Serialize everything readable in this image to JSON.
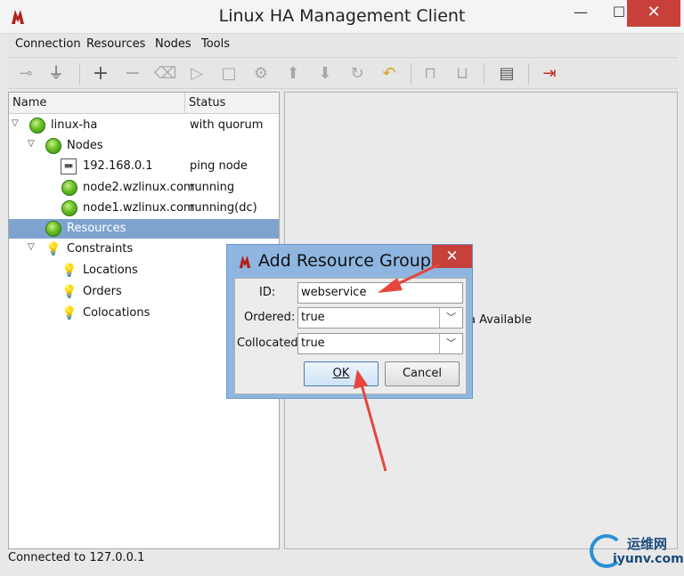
{
  "window": {
    "title": "Linux HA Management Client",
    "minimize": "—",
    "maximize": "☐",
    "close": "✕"
  },
  "menu": [
    "Connection",
    "Resources",
    "Nodes",
    "Tools"
  ],
  "tree": {
    "headers": {
      "name": "Name",
      "status": "Status"
    },
    "rows": [
      {
        "label": "linux-ha",
        "status": "with quorum",
        "icon": "green-status-icon"
      },
      {
        "label": "Nodes",
        "status": "",
        "icon": "green-status-icon"
      },
      {
        "label": "192.168.0.1",
        "status": "ping node",
        "icon": "computer-icon"
      },
      {
        "label": "node2.wzlinux.com",
        "status": "running",
        "icon": "green-status-icon"
      },
      {
        "label": "node1.wzlinux.com",
        "status": "running(dc)",
        "icon": "green-status-icon"
      },
      {
        "label": "Resources",
        "status": "",
        "icon": "green-status-icon"
      },
      {
        "label": "Constraints",
        "status": "",
        "icon": "lightbulb-icon"
      },
      {
        "label": "Locations",
        "status": "",
        "icon": "lightbulb-icon"
      },
      {
        "label": "Orders",
        "status": "",
        "icon": "lightbulb-icon"
      },
      {
        "label": "Colocations",
        "status": "",
        "icon": "lightbulb-icon"
      }
    ]
  },
  "right_panel": {
    "text": "a Available"
  },
  "statusbar": {
    "text": "Connected to 127.0.0.1"
  },
  "dialog": {
    "title": "Add Resource Group",
    "close": "✕",
    "id_label": "ID:",
    "id_value": "webservice",
    "ordered_label": "Ordered:",
    "ordered_value": "true",
    "collocated_label": "Collocated:",
    "collocated_value": "true",
    "ok_label": "OK",
    "cancel_label": "Cancel"
  },
  "watermark": {
    "cn": "运维网",
    "en": "iyunv.com"
  },
  "colors": {
    "selection": "#7fa3cf",
    "dialog_frame": "#8eb6e0",
    "close_red": "#c7403a",
    "arrow_red": "#e8453c"
  }
}
